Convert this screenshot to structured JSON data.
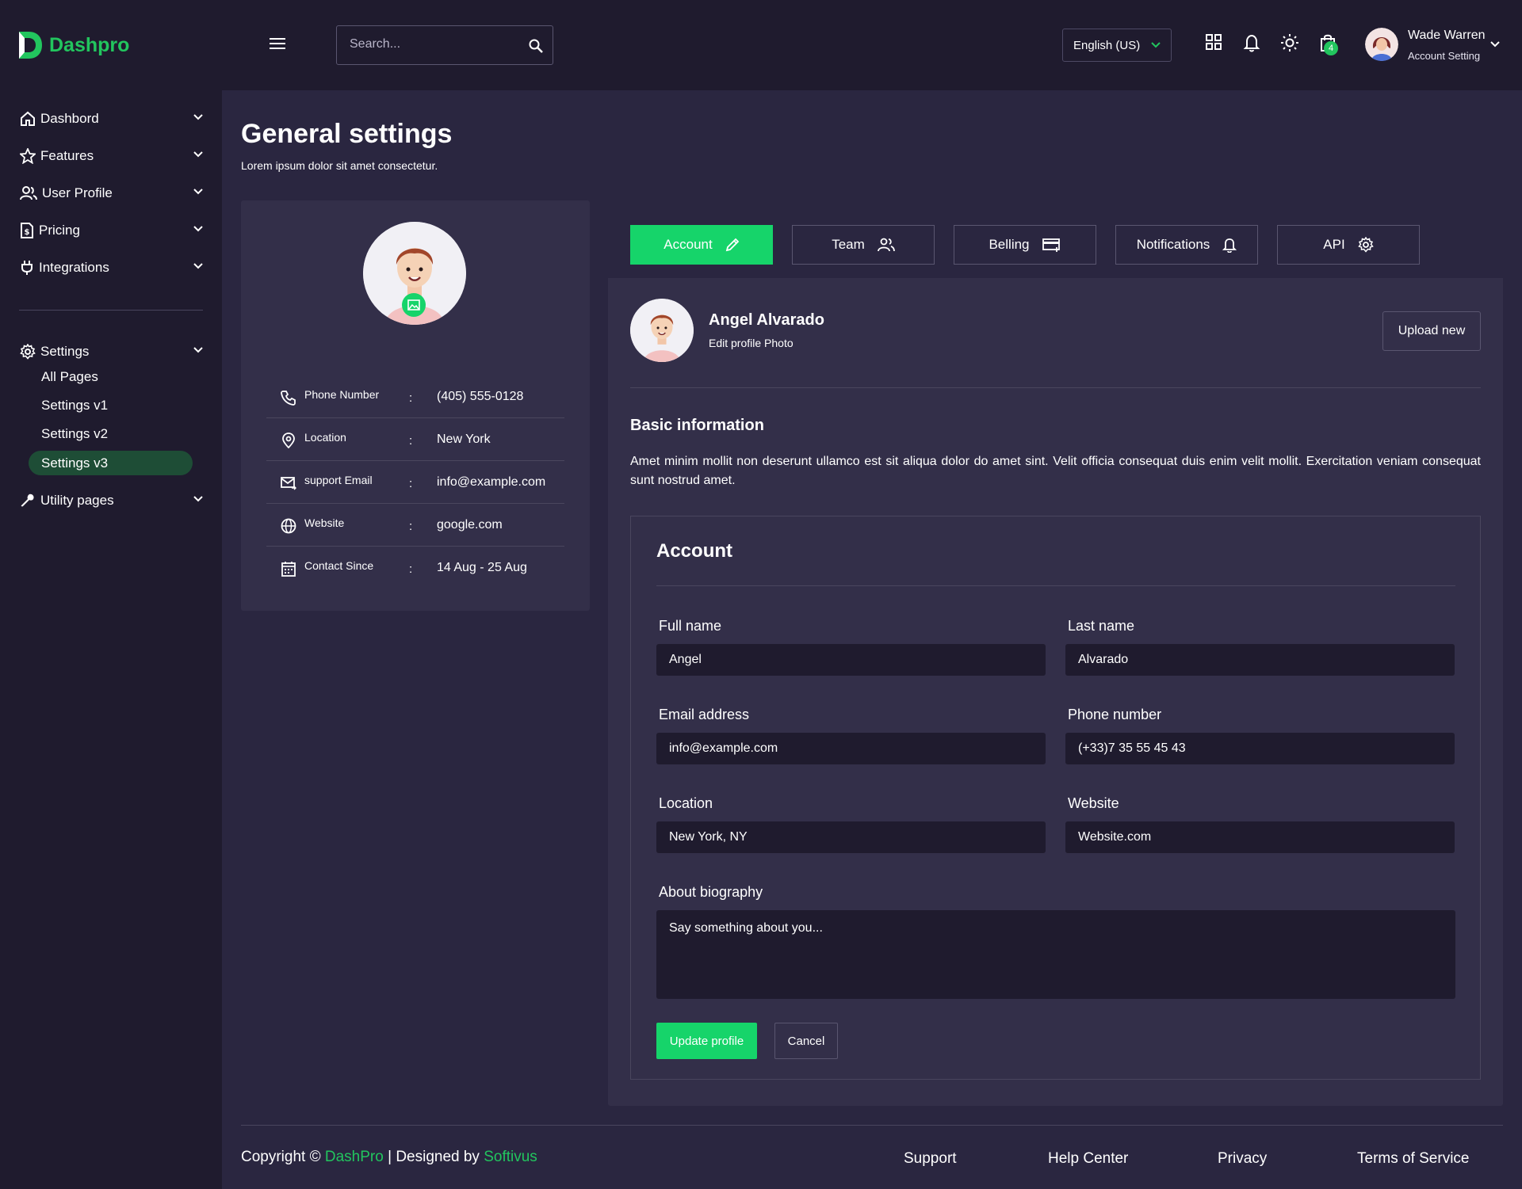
{
  "brand": {
    "name": "Dashpro",
    "accent": "#22c55e"
  },
  "header": {
    "search_placeholder": "Search...",
    "language": "English (US)",
    "cart_count": "4",
    "user": {
      "name": "Wade Warren",
      "subtitle": "Account Setting"
    }
  },
  "sidebar": {
    "items": [
      {
        "label": "Dashbord",
        "icon": "home-icon"
      },
      {
        "label": "Features",
        "icon": "star-icon"
      },
      {
        "label": "User Profile",
        "icon": "users-icon"
      },
      {
        "label": "Pricing",
        "icon": "document-dollar-icon"
      },
      {
        "label": "Integrations",
        "icon": "plug-icon"
      }
    ],
    "settings": {
      "label": "Settings",
      "children": [
        "All Pages",
        "Settings v1",
        "Settings v2",
        "Settings v3"
      ],
      "active": "Settings v3"
    },
    "utility": {
      "label": "Utility pages"
    }
  },
  "page": {
    "title": "General settings",
    "subtitle": "Lorem ipsum dolor sit amet consectetur."
  },
  "profile_card": {
    "rows": [
      {
        "label": "Phone Number",
        "value": "(405) 555-0128",
        "icon": "phone-icon"
      },
      {
        "label": "Location",
        "value": "New York",
        "icon": "map-pin-icon"
      },
      {
        "label": "support Email",
        "value": "info@example.com",
        "icon": "mail-icon"
      },
      {
        "label": "Website",
        "value": "google.com",
        "icon": "globe-icon"
      },
      {
        "label": "Contact Since",
        "value": "14 Aug - 25 Aug",
        "icon": "calendar-icon"
      }
    ],
    "colon": ":"
  },
  "tabs": [
    {
      "label": "Account",
      "icon": "pencil-icon",
      "active": true
    },
    {
      "label": "Team",
      "icon": "team-icon",
      "active": false
    },
    {
      "label": "Belling",
      "icon": "credit-card-icon",
      "active": false
    },
    {
      "label": "Notifications",
      "icon": "bell-icon",
      "active": false
    },
    {
      "label": "API",
      "icon": "gear-icon",
      "active": false
    }
  ],
  "photo_section": {
    "name": "Angel Alvarado",
    "subtitle": "Edit profile Photo",
    "upload_label": "Upload new"
  },
  "basic_info": {
    "title": "Basic information",
    "text": "Amet minim mollit non deserunt ullamco est sit aliqua dolor do amet sint. Velit officia consequat duis enim velit mollit. Exercitation veniam consequat sunt nostrud amet."
  },
  "account_form": {
    "title": "Account",
    "full_name_label": "Full name",
    "full_name": "Angel",
    "last_name_label": "Last name",
    "last_name": "Alvarado",
    "email_label": "Email address",
    "email": "info@example.com",
    "phone_label": "Phone number",
    "phone": "(+33)7 35 55 45 43",
    "location_label": "Location",
    "location": "New York, NY",
    "website_label": "Website",
    "website": "Website.com",
    "bio_label": "About biography",
    "bio_placeholder": "Say something about you...",
    "update_label": "Update profile",
    "cancel_label": "Cancel"
  },
  "footer": {
    "copyright_prefix": "Copyright ©",
    "brand": "DashPro",
    "separator": "|",
    "designed_by": "Designed by",
    "designer": "Softivus",
    "links": [
      "Support",
      "Help Center",
      "Privacy",
      "Terms of Service"
    ]
  }
}
